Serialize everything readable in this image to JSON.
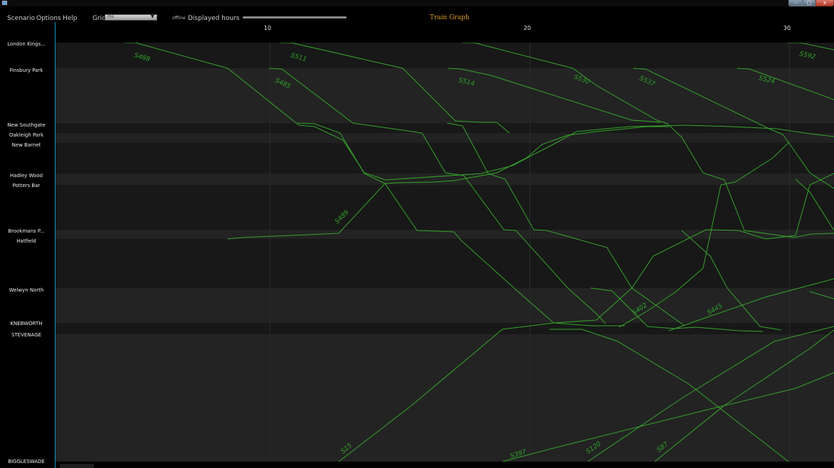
{
  "menubar": {
    "menus": [
      "Scenario",
      "Options",
      "Help"
    ],
    "grid_label": "Grid",
    "grid_value": "ms",
    "grid_arrow": "▼",
    "offline_label": "offline",
    "displayed_hours_label": "Displayed hours",
    "displayed_hours_level": 1.0,
    "app_title": "Train Graph"
  },
  "window": {
    "icon": "app-window-icon",
    "min_glyph": "–",
    "max_glyph": "□",
    "close_glyph": "x"
  },
  "axis": {
    "hour_labels": [
      "10",
      "20",
      "30"
    ]
  },
  "stations": [
    "London Kings...",
    "Finsbury Park",
    "New Southgate",
    "Oakleigh Park",
    "New Barnet",
    "Hadley Wood",
    "Potters Bar",
    "Brookmans P...",
    "Hatfield",
    "Welwyn North",
    "KNEBWORTH",
    "STEVENAGE",
    "BIGGLESWADE"
  ],
  "trains": [
    {
      "id": "S488"
    },
    {
      "id": "S511"
    },
    {
      "id": "S485"
    },
    {
      "id": "S514"
    },
    {
      "id": "S530"
    },
    {
      "id": "S537"
    },
    {
      "id": "S524"
    },
    {
      "id": "S592"
    },
    {
      "id": "S489"
    },
    {
      "id": "S402"
    },
    {
      "id": "S445"
    },
    {
      "id": "S15"
    },
    {
      "id": "S397"
    },
    {
      "id": "S120"
    },
    {
      "id": "S87"
    }
  ],
  "colors": {
    "train_line": "#35a52a",
    "station_divider": "#1b8fb8",
    "title": "#e0a020",
    "band_dark": "#181818",
    "band_light": "#222222"
  }
}
